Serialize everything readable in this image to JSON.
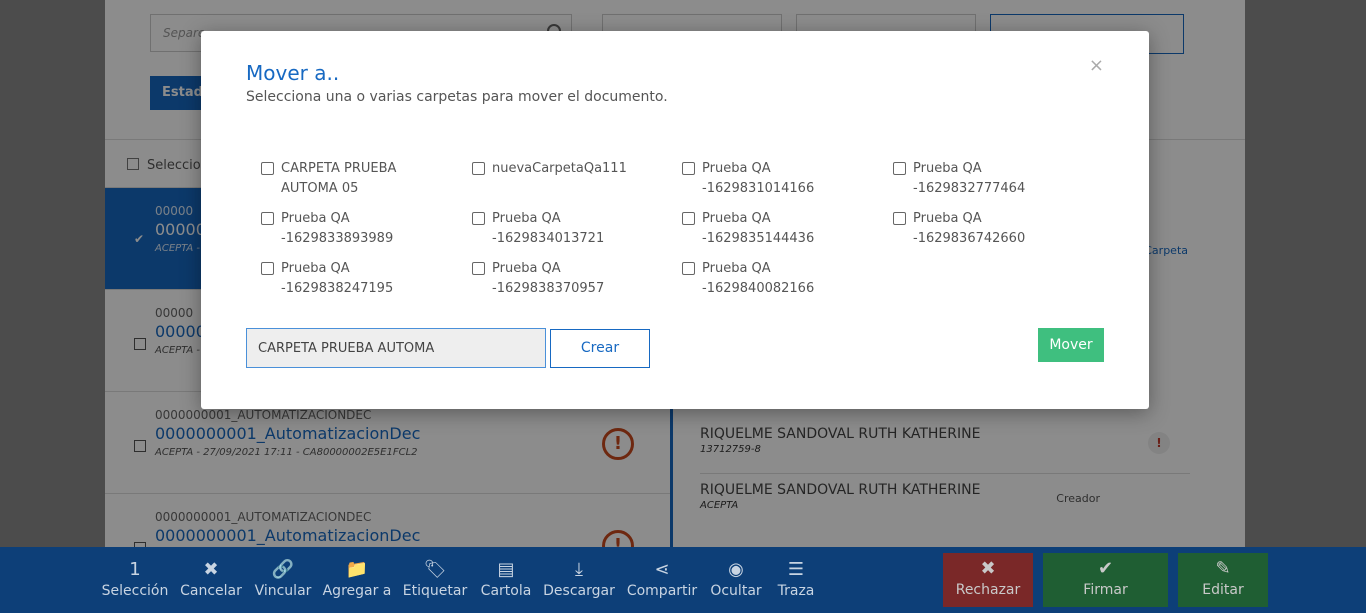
{
  "background": {
    "search_placeholder": "Separe",
    "estado_label": "Estad",
    "list_header": "Seleccio",
    "rows": [
      {
        "code": "00000",
        "title": "00000",
        "meta": "ACEPTA -",
        "checked": true
      },
      {
        "code": "00000",
        "title": "00000",
        "meta": "ACEPTA -",
        "checked": false
      },
      {
        "code": "0000000001_AUTOMATIZACIONDEC",
        "title": "0000000001_AutomatizacionDec",
        "meta": "ACEPTA - 27/09/2021 17:11 - CA80000002E5E1FCL2",
        "checked": false
      },
      {
        "code": "0000000001_AUTOMATIZACIONDEC",
        "title": "0000000001_AutomatizacionDec",
        "meta": "",
        "checked": false
      }
    ],
    "detail": {
      "carpeta_link": "Carpeta",
      "signers": [
        {
          "name": "RIQUELME SANDOVAL RUTH KATHERINE",
          "sub": "13712759-8",
          "flag": "!"
        },
        {
          "name": "RIQUELME SANDOVAL RUTH KATHERINE",
          "sub": "ACEPTA",
          "role": "Creador"
        }
      ]
    }
  },
  "toolbar": {
    "items": [
      {
        "icon": "1",
        "label": "Selección",
        "name": "selection-count"
      },
      {
        "icon": "✖",
        "label": "Cancelar",
        "name": "cancel"
      },
      {
        "icon": "🔗",
        "label": "Vincular",
        "name": "link"
      },
      {
        "icon": "📁",
        "label": "Agregar a",
        "name": "add-to"
      },
      {
        "icon": "🏷",
        "label": "Etiquetar",
        "name": "tag"
      },
      {
        "icon": "▤",
        "label": "Cartola",
        "name": "cartola"
      },
      {
        "icon": "⤓",
        "label": "Descargar",
        "name": "download"
      },
      {
        "icon": "⋖",
        "label": "Compartir",
        "name": "share"
      },
      {
        "icon": "◉",
        "label": "Ocultar",
        "name": "hide"
      },
      {
        "icon": "☰",
        "label": "Traza",
        "name": "trace"
      }
    ],
    "rechazar": {
      "icon": "✖",
      "label": "Rechazar"
    },
    "firmar": {
      "icon": "✔",
      "label": "Firmar"
    },
    "editar": {
      "icon": "✎",
      "label": "Editar"
    }
  },
  "modal": {
    "title": "Mover a..",
    "subtitle": "Selecciona una o varias carpetas para mover el documento.",
    "close": "×",
    "folders": [
      {
        "line1": "CARPETA PRUEBA",
        "line2": "AUTOMA 05"
      },
      {
        "line1": "nuevaCarpetaQa111",
        "line2": ""
      },
      {
        "line1": "Prueba QA",
        "line2": "-1629831014166"
      },
      {
        "line1": "Prueba QA",
        "line2": "-1629832777464"
      },
      {
        "line1": "Prueba QA",
        "line2": "-1629833893989"
      },
      {
        "line1": "Prueba QA",
        "line2": "-1629834013721"
      },
      {
        "line1": "Prueba QA",
        "line2": "-1629835144436"
      },
      {
        "line1": "Prueba QA",
        "line2": "-1629836742660"
      },
      {
        "line1": "Prueba QA",
        "line2": "-1629838247195"
      },
      {
        "line1": "Prueba QA",
        "line2": "-1629838370957"
      },
      {
        "line1": "Prueba QA",
        "line2": "-1629840082166"
      }
    ],
    "new_folder_value": "CARPETA PRUEBA AUTOMA",
    "crear_label": "Crear",
    "mover_label": "Mover"
  }
}
